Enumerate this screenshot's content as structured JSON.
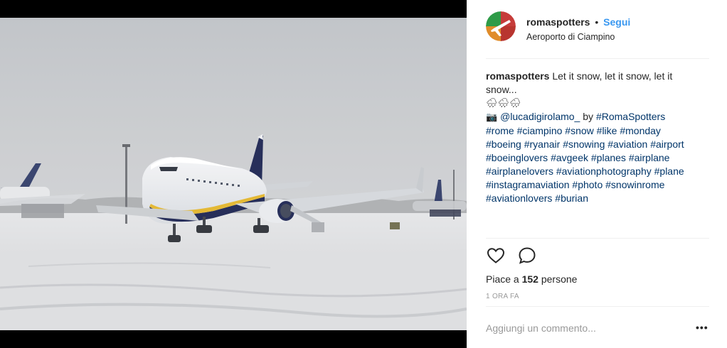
{
  "post": {
    "username": "romaspotters",
    "separator": "•",
    "follow_label": "Segui",
    "location": "Aeroporto di Ciampino",
    "caption": {
      "username": "romaspotters",
      "text_line1": "Let it snow, let it snow, let it",
      "text_line2": "snow...",
      "weather_emojis": "🌧🌧🌧",
      "camera_emoji": "📷",
      "mention": "@lucadigirolamo_",
      "by_text": "by",
      "hashtag_roma": "#RomaSpotters",
      "hashtags": [
        [
          "#rome",
          "#ciampino",
          "#snow",
          "#like",
          "#monday"
        ],
        [
          "#boeing",
          "#ryanair",
          "#snowing",
          "#aviation",
          "#airport"
        ],
        [
          "#boeinglovers",
          "#avgeek",
          "#planes",
          "#airplane"
        ],
        [
          "#airplanelovers",
          "#aviationphotography",
          "#plane"
        ],
        [
          "#instagramaviation",
          "#photo",
          "#snowinrome"
        ],
        [
          "#aviationlovers",
          "#burian"
        ]
      ]
    },
    "likes_prefix": "Piace a",
    "likes_count": "152",
    "likes_suffix": "persone",
    "timestamp": "1 ORA FA",
    "comment_placeholder": "Aggiungi un commento...",
    "more_label": "•••",
    "icons": {
      "like": "heart-icon",
      "comment": "comment-bubble-icon",
      "more": "more-options-icon"
    },
    "colors": {
      "link": "#003569",
      "follow": "#3897f0",
      "muted": "#999999"
    }
  }
}
